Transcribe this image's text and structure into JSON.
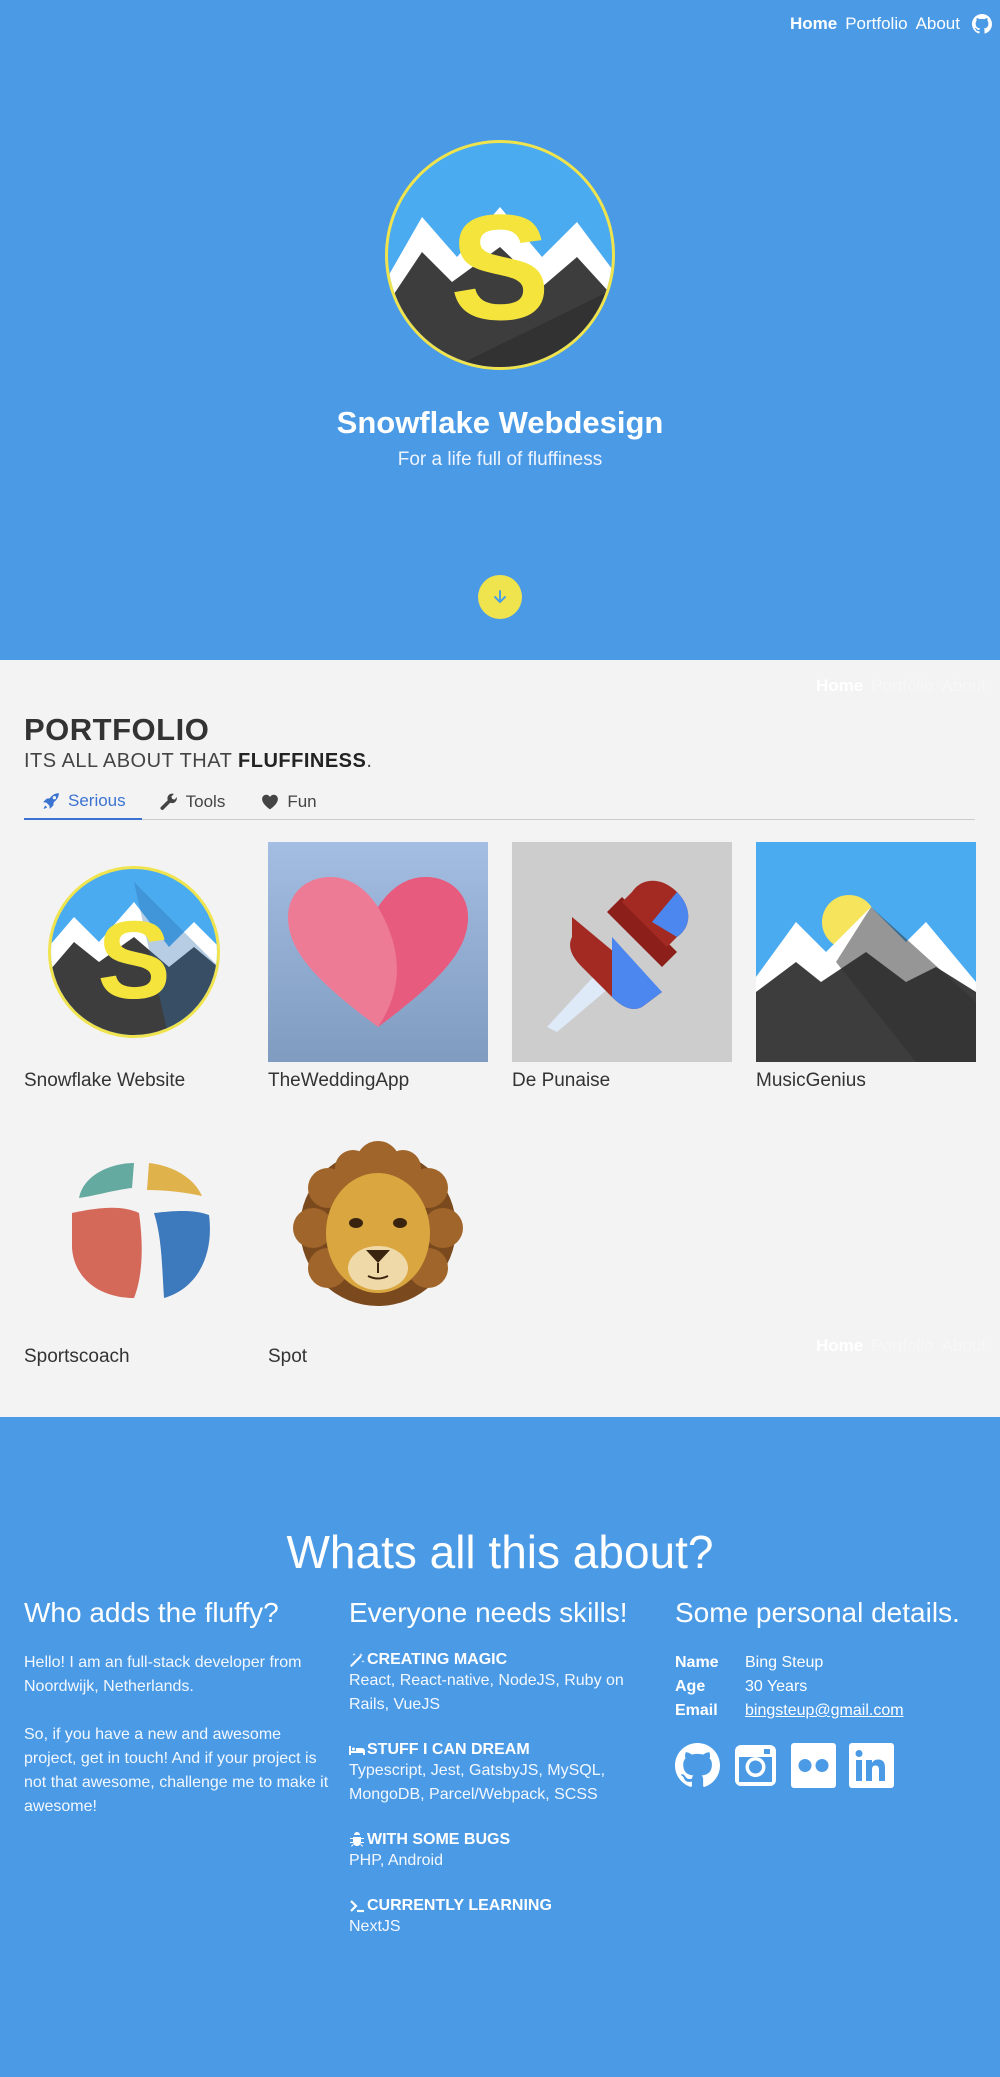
{
  "nav": {
    "items": [
      "Home",
      "Portfolio",
      "About"
    ],
    "active": "Home"
  },
  "hero": {
    "title": "Snowflake Webdesign",
    "subtitle": "For a life full of fluffiness"
  },
  "portfolio": {
    "title": "PORTFOLIO",
    "subtitle_plain": "ITS ALL ABOUT THAT ",
    "subtitle_bold": "FLUFFINESS",
    "subtitle_end": ".",
    "tabs": [
      {
        "label": "Serious",
        "icon": "rocket-icon"
      },
      {
        "label": "Tools",
        "icon": "wrench-icon"
      },
      {
        "label": "Fun",
        "icon": "heart-icon"
      }
    ],
    "projects": [
      "Snowflake Website",
      "TheWeddingApp",
      "De Punaise",
      "MusicGenius",
      "Sportscoach",
      "Spot"
    ]
  },
  "about": {
    "title": "Whats all this about?",
    "who": {
      "heading": "Who adds the fluffy?",
      "p1": "Hello! I am an full-stack developer from Noordwijk, Netherlands.",
      "p2": "So, if you have a new and awesome project, get in touch! And if your project is not that awesome, challenge me to make it awesome!"
    },
    "skills": {
      "heading": "Everyone needs skills!",
      "items": [
        {
          "title": "Creating Magic",
          "icon": "magic-wand-icon",
          "value": "React, React-native, NodeJS, Ruby on Rails, VueJS"
        },
        {
          "title": "Stuff I can dream",
          "icon": "bed-icon",
          "value": "Typescript, Jest, GatsbyJS, MySQL, MongoDB, Parcel/Webpack, SCSS"
        },
        {
          "title": "With some bugs",
          "icon": "bug-icon",
          "value": "PHP, Android"
        },
        {
          "title": "Currently learning",
          "icon": "terminal-icon",
          "value": "NextJS"
        }
      ]
    },
    "personal": {
      "heading": "Some personal details.",
      "name_label": "Name",
      "name": "Bing Steup",
      "age_label": "Age",
      "age": "30 Years",
      "email_label": "Email",
      "email": "bingsteup@gmail.com",
      "socials": [
        "github-icon",
        "instagram-icon",
        "flickr-icon",
        "linkedin-icon"
      ]
    }
  },
  "colors": {
    "primary": "#4a9ae6",
    "accent": "#f0e44e",
    "tab_active": "#3b73d1",
    "portfolio_bg": "#f4f3f3"
  }
}
